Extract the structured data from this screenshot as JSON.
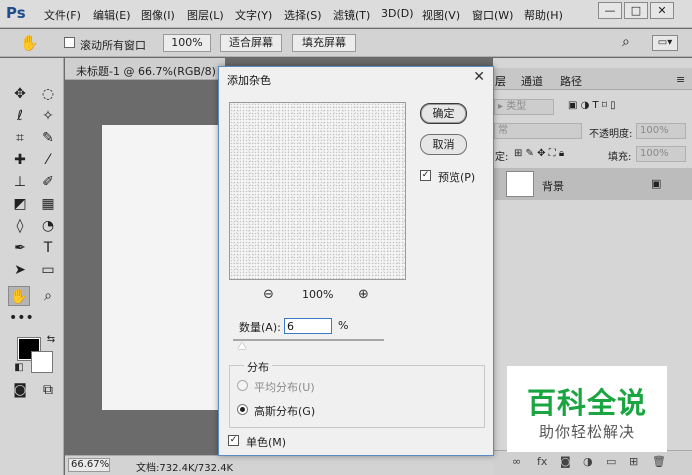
{
  "app": {
    "logo": "Ps",
    "menu": [
      "文件(F)",
      "编辑(E)",
      "图像(I)",
      "图层(L)",
      "文字(Y)",
      "选择(S)",
      "滤镜(T)",
      "3D(D)",
      "视图(V)",
      "窗口(W)",
      "帮助(H)"
    ],
    "window_controls": {
      "minimize": "—",
      "restore": "□",
      "close": "✕"
    }
  },
  "options_bar": {
    "scroll_all_label": "滚动所有窗口",
    "zoom_100": "100%",
    "fit_screen": "适合屏幕",
    "fill_screen": "填充屏幕"
  },
  "document": {
    "tab_title": "未标题-1 @ 66.7%(RGB/8)",
    "zoom": "66.67%",
    "doc_info": "文档:732.4K/732.4K"
  },
  "layers_panel": {
    "tabs": [
      "层",
      "通道",
      "路径"
    ],
    "filter_kind": "类型",
    "blend_mode": "常",
    "opacity_label": "不透明度:",
    "opacity_value": "100%",
    "lock_label": "定:",
    "fill_label": "填充:",
    "fill_value": "100%",
    "layer_name": "背景"
  },
  "dialog": {
    "title": "添加杂色",
    "ok": "确定",
    "cancel": "取消",
    "preview_label": "预览(P)",
    "preview_checked": true,
    "zoom_level": "100%",
    "amount_label": "数量(A):",
    "amount_value": "6",
    "amount_unit": "%",
    "amount_percent": 6,
    "distribution_label": "分布",
    "uniform_label": "平均分布(U)",
    "gaussian_label": "高斯分布(G)",
    "selected_distribution": "gaussian",
    "monochrome_label": "单色(M)",
    "monochrome_checked": true
  },
  "watermark": {
    "main": "百科全说",
    "sub": "助你轻松解决"
  }
}
